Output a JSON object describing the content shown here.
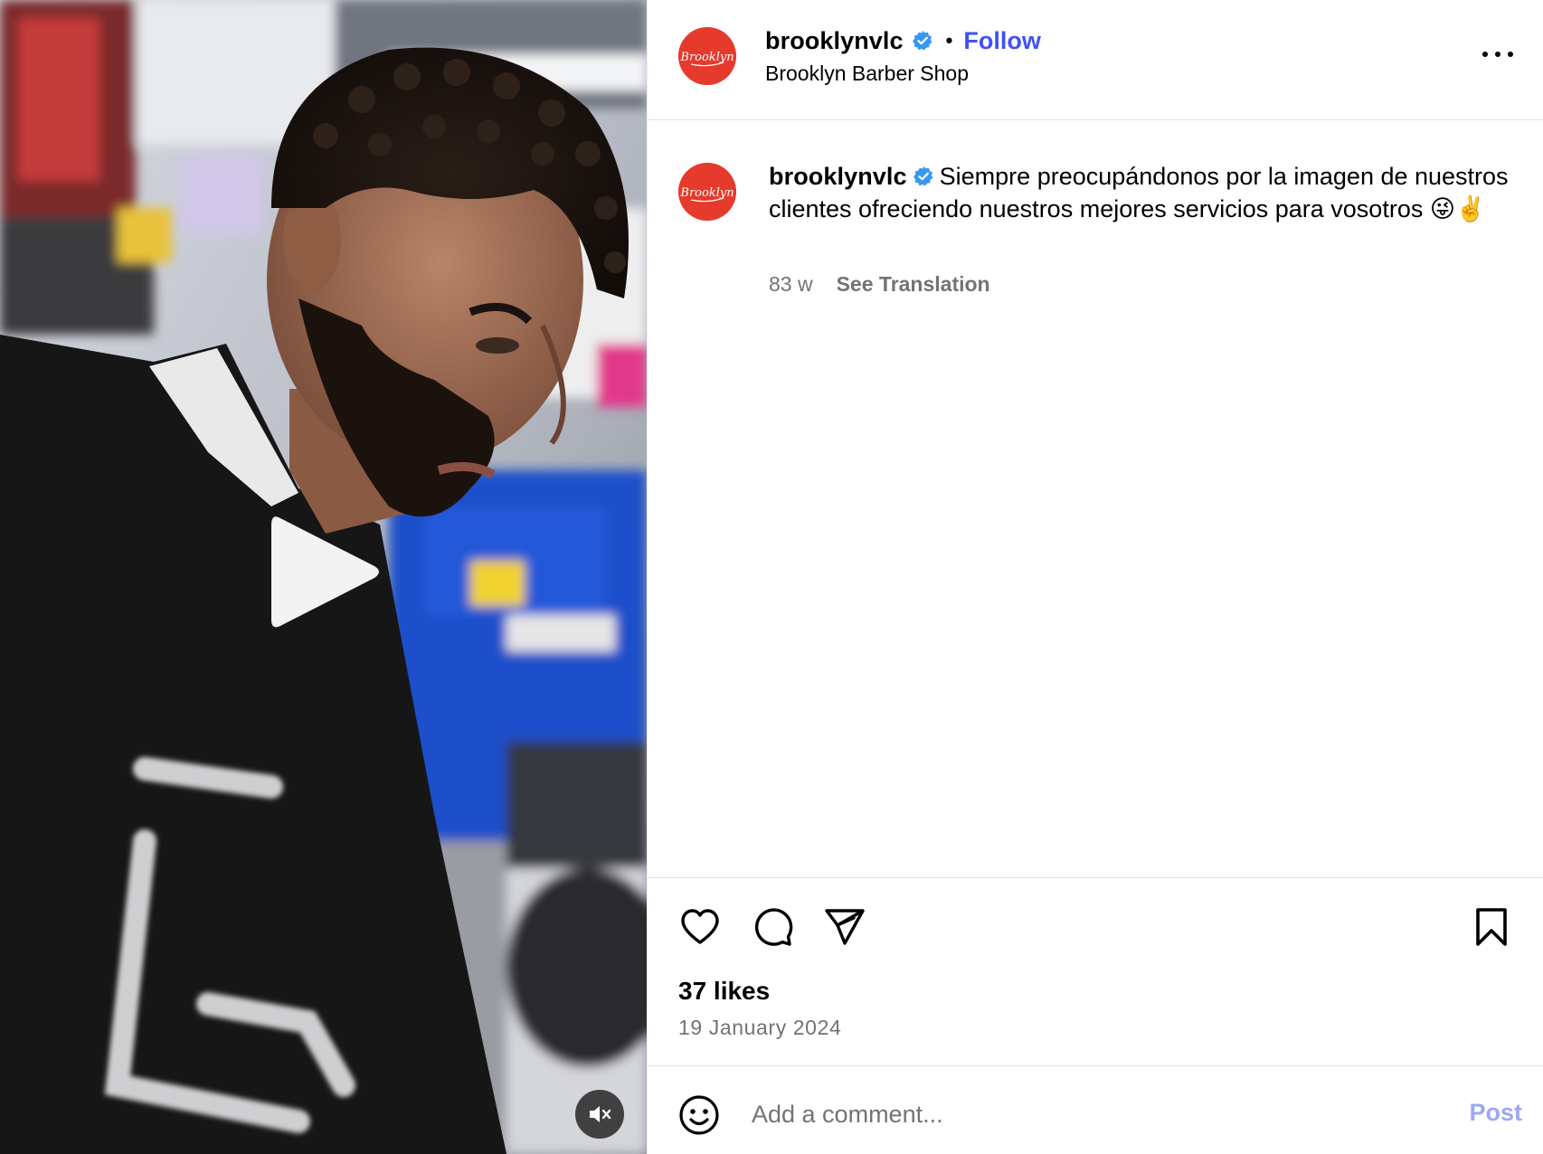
{
  "media": {
    "play_icon": "play-icon",
    "mute_icon": "speaker-muted-icon"
  },
  "header": {
    "username": "brooklynvlc",
    "follow_label": "Follow",
    "separator": "•",
    "location": "Brooklyn Barber Shop",
    "avatar_text": "Brooklyn"
  },
  "caption": {
    "username": "brooklynvlc",
    "text": "Siempre preocupándonos por la imagen de nuestros clientes ofreciendo nuestros mejores servicios para vosotros 😜✌️",
    "age": "83 w",
    "translate_label": "See Translation"
  },
  "actions": {
    "icons": [
      "heart-icon",
      "comment-icon",
      "share-icon",
      "bookmark-icon"
    ]
  },
  "stats": {
    "likes": "37 likes",
    "date": "19 January 2024"
  },
  "comment": {
    "placeholder": "Add a comment...",
    "post_label": "Post"
  },
  "colors": {
    "accent": "#4150f7",
    "verified": "#3897f0",
    "avatar_bg": "#e53a2c",
    "muted_text": "#737373",
    "post_disabled": "#9ea8f5"
  }
}
